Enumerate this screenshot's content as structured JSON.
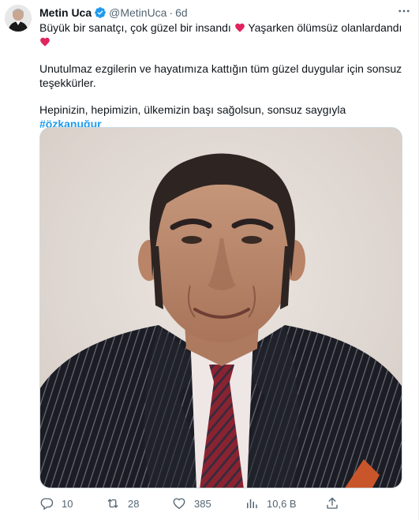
{
  "author": {
    "name": "Metin Uca",
    "handle": "@MetinUca",
    "separator": "·",
    "time": "6d"
  },
  "tweet": {
    "line1_a": "Büyük bir sanatçı, çok güzel bir insandı",
    "line1_b": " Yaşarken ölümsüz olanlardandı",
    "para2": "Unutulmaz ezgilerin ve hayatımıza kattığın tüm güzel duygular için sonsuz teşekkürler.",
    "para3": "Hepinizin, hepimizin, ülkemizin başı sağolsun, sonsuz saygıyla",
    "hashtag": "#özkanuğur"
  },
  "actions": {
    "replies": "10",
    "retweets": "28",
    "likes": "385",
    "views": "10,6 B"
  },
  "colors": {
    "accent": "#1d9bf0",
    "heart": "#e0245e",
    "muted": "#536471",
    "text": "#0f1419"
  },
  "icons": {
    "verified": "verified-badge-icon",
    "heart": "red-heart-emoji-icon",
    "more": "more-options-icon",
    "reply": "reply-icon",
    "retweet": "retweet-icon",
    "like": "like-icon",
    "views": "views-icon",
    "share": "share-icon"
  }
}
